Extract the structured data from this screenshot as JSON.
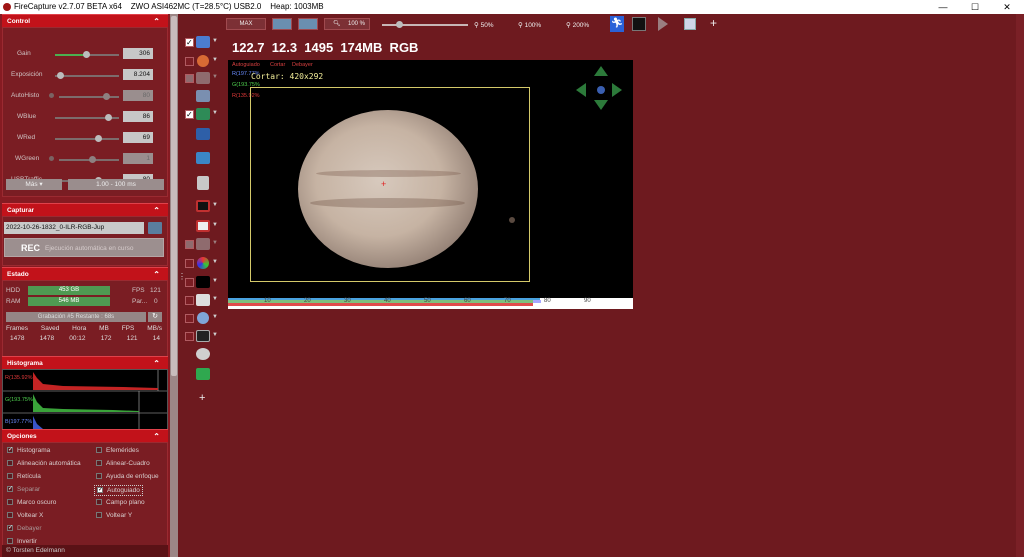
{
  "titlebar": {
    "app": "FireCapture v2.7.07 BETA x64",
    "camera": "ZWO ASI462MC (T=28.5°C) USB2.0",
    "heap": "Heap: 1003MB",
    "min": "—",
    "max": "☐",
    "close": "✕"
  },
  "control": {
    "title": "Control",
    "rows": [
      {
        "label": "Gain",
        "value": "306"
      },
      {
        "label": "Exposición",
        "value": "8.204"
      },
      {
        "label": "AutoHisto",
        "value": "80"
      },
      {
        "label": "WBlue",
        "value": "86"
      },
      {
        "label": "WRed",
        "value": "69"
      },
      {
        "label": "WGreen",
        "value": "1"
      },
      {
        "label": "USBTraffic",
        "value": "80"
      }
    ],
    "mas": "Más",
    "range": "1.00 - 100 ms"
  },
  "capturar": {
    "title": "Capturar",
    "filename": "2022-10-26-1832_0-ILR-RGB-Jup",
    "rec": "REC",
    "auto": "Ejecución automática en curso"
  },
  "estado": {
    "title": "Estado",
    "hdd_label": "HDD",
    "hdd": "453 GB",
    "ram_label": "RAM",
    "ram": "546 MB",
    "fps_label": "FPS",
    "fps": "121",
    "par_label": "Par...",
    "par": "0",
    "grab": "Grabación #5   Restante : 68s",
    "headers": [
      "Frames",
      "Saved",
      "Hora",
      "MB",
      "FPS",
      "MB/s"
    ],
    "values": [
      "1478",
      "1478",
      "00:12",
      "172",
      "121",
      "14"
    ]
  },
  "histograma": {
    "title": "Histograma",
    "r": "R(135.92%",
    "g": "G(193.75%",
    "b": "B(197.77%"
  },
  "opciones": {
    "title": "Opciones",
    "left": [
      {
        "label": "Histograma",
        "checked": true
      },
      {
        "label": "Alineación automática",
        "checked": false
      },
      {
        "label": "Retícula",
        "checked": false
      },
      {
        "label": "Separar",
        "checked": true
      },
      {
        "label": "Marco oscuro",
        "checked": false
      },
      {
        "label": "Voltear X",
        "checked": false
      },
      {
        "label": "Debayer",
        "checked": true
      },
      {
        "label": "Invertir",
        "checked": false
      }
    ],
    "right": [
      {
        "label": "Efemérides",
        "checked": false
      },
      {
        "label": "Alinear-Cuadro",
        "checked": false
      },
      {
        "label": "Ayuda de enfoque",
        "checked": false
      },
      {
        "label": "Autoguiado",
        "checked": true
      },
      {
        "label": "Campo plano",
        "checked": false
      },
      {
        "label": "Voltear Y",
        "checked": false
      }
    ],
    "footer": "Torsten Edelmann"
  },
  "toolbar": {
    "max": "MAX",
    "zoom100": "100 %",
    "z50": "50%",
    "z100": "100%",
    "z200": "200%",
    "plus": "+"
  },
  "stats": "122.7  12.3  1495  174MB  RGB",
  "overlay": {
    "autoguiado": "Autoguiado",
    "cortar_btn": "Cortar",
    "debayer": "Debayer",
    "cortar": "Cortar: 420x292",
    "r": "R(197.77%",
    "g": "G(193.75%",
    "b": "R(135.92%"
  },
  "ticks": [
    "10",
    "20",
    "30",
    "40",
    "50",
    "60",
    "70",
    "80",
    "90"
  ],
  "side": {
    "plus": "+"
  }
}
